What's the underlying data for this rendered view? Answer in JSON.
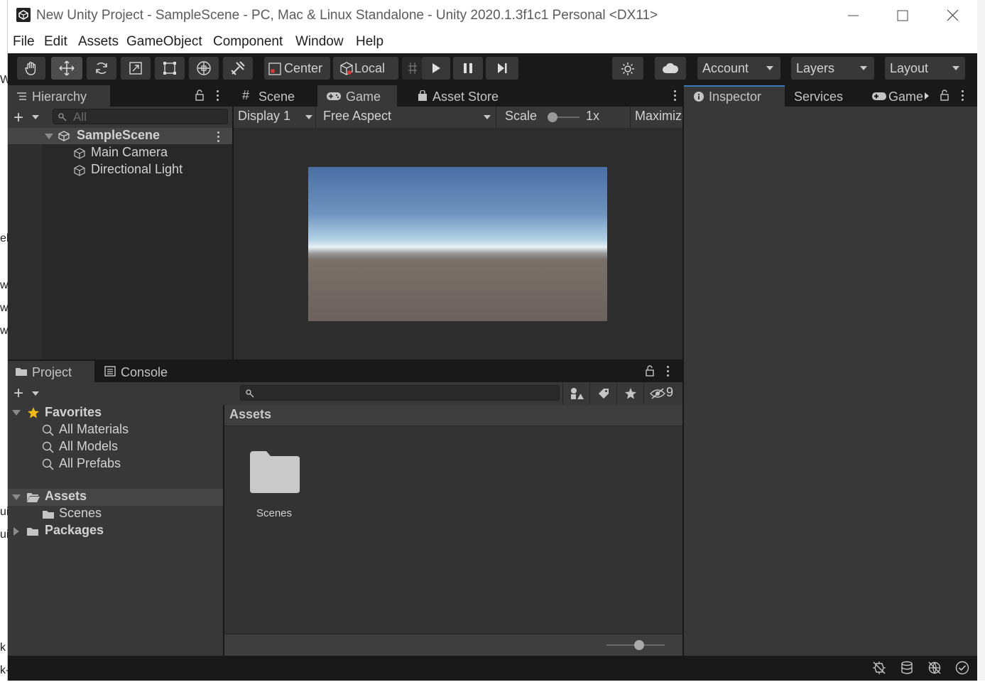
{
  "window": {
    "title": "New Unity Project - SampleScene - PC, Mac & Linux Standalone - Unity 2020.1.3f1c1 Personal <DX11>"
  },
  "menu": [
    "File",
    "Edit",
    "Assets",
    "GameObject",
    "Component",
    "Window",
    "Help"
  ],
  "toolbar": {
    "pivot_label": "Center",
    "space_label": "Local",
    "account_label": "Account",
    "layers_label": "Layers",
    "layout_label": "Layout"
  },
  "hierarchy": {
    "tab_label": "Hierarchy",
    "search_placeholder": "All",
    "scene_name": "SampleScene",
    "items": [
      "Main Camera",
      "Directional Light"
    ]
  },
  "scene_tabs": {
    "scene": "Scene",
    "game": "Game",
    "asset_store": "Asset Store"
  },
  "game_toolbar": {
    "display": "Display 1",
    "aspect": "Free Aspect",
    "scale_label": "Scale",
    "scale_value": "1x",
    "maximize": "Maximize"
  },
  "inspector_tabs": {
    "inspector": "Inspector",
    "services": "Services",
    "game": "Game"
  },
  "project": {
    "tab_label": "Project",
    "console_label": "Console",
    "hidden_count": "9",
    "favorites_label": "Favorites",
    "favorites": [
      "All Materials",
      "All Models",
      "All Prefabs"
    ],
    "assets_label": "Assets",
    "assets_children": [
      "Scenes"
    ],
    "packages_label": "Packages",
    "breadcrumb": "Assets",
    "grid_items": [
      "Scenes"
    ]
  },
  "background_chars": [
    "W",
    "el",
    "w",
    "w",
    "w",
    "ui",
    "ui",
    "k",
    "k-"
  ],
  "colors": {
    "editor_dark": "#282828",
    "panel": "#383838",
    "toolbar": "#191919",
    "accent": "#3a79bb",
    "sky_top": "#4a6fa5",
    "ground": "#6b625d"
  }
}
